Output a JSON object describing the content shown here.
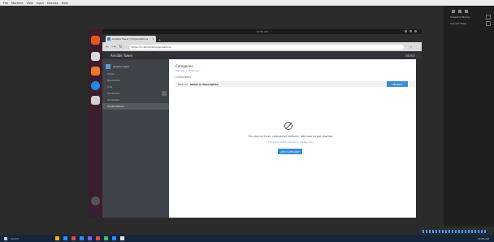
{
  "host_menu": [
    "File",
    "Machine",
    "View",
    "Input",
    "Devices",
    "Help"
  ],
  "vm_title": "10:56 AM",
  "browser": {
    "tab_title": "Ansible Tower | Organizations",
    "tab_close": "×",
    "new_tab": "+",
    "url": "https://localhost/#/organizations"
  },
  "app": {
    "name": "Ansible Tower",
    "user": "admin"
  },
  "sidebar": {
    "title": "Ansible Tower",
    "items": [
      {
        "label": "Views"
      },
      {
        "label": "Dashboard"
      },
      {
        "label": "Jobs"
      },
      {
        "label": "Schedules"
      },
      {
        "label": "Templates"
      },
      {
        "label": "Credentials"
      },
      {
        "label": "Organizations"
      }
    ]
  },
  "main": {
    "title": "Categories",
    "subtitle": "Manage Categories",
    "label": "CATEGORIES",
    "filter_prefix": "Filter by",
    "filter_value": "Name or Description",
    "filter_button": "SEARCH",
    "empty_message": "You do not have categories defined. Add one to get started.",
    "empty_sub": "Click the button below to create one.",
    "empty_button": "ADD CATEGORY"
  },
  "right_panel": {
    "rows": [
      "Snapshot Name",
      "Current State"
    ]
  },
  "taskbar": {
    "search": "Search",
    "tray": "10:56 AM"
  },
  "colors": {
    "accent": "#3c8dd1",
    "sidebar_bg": "#3d4348",
    "launcher_bg": "#3a1d2e",
    "taskbar_bg": "#15253b"
  }
}
